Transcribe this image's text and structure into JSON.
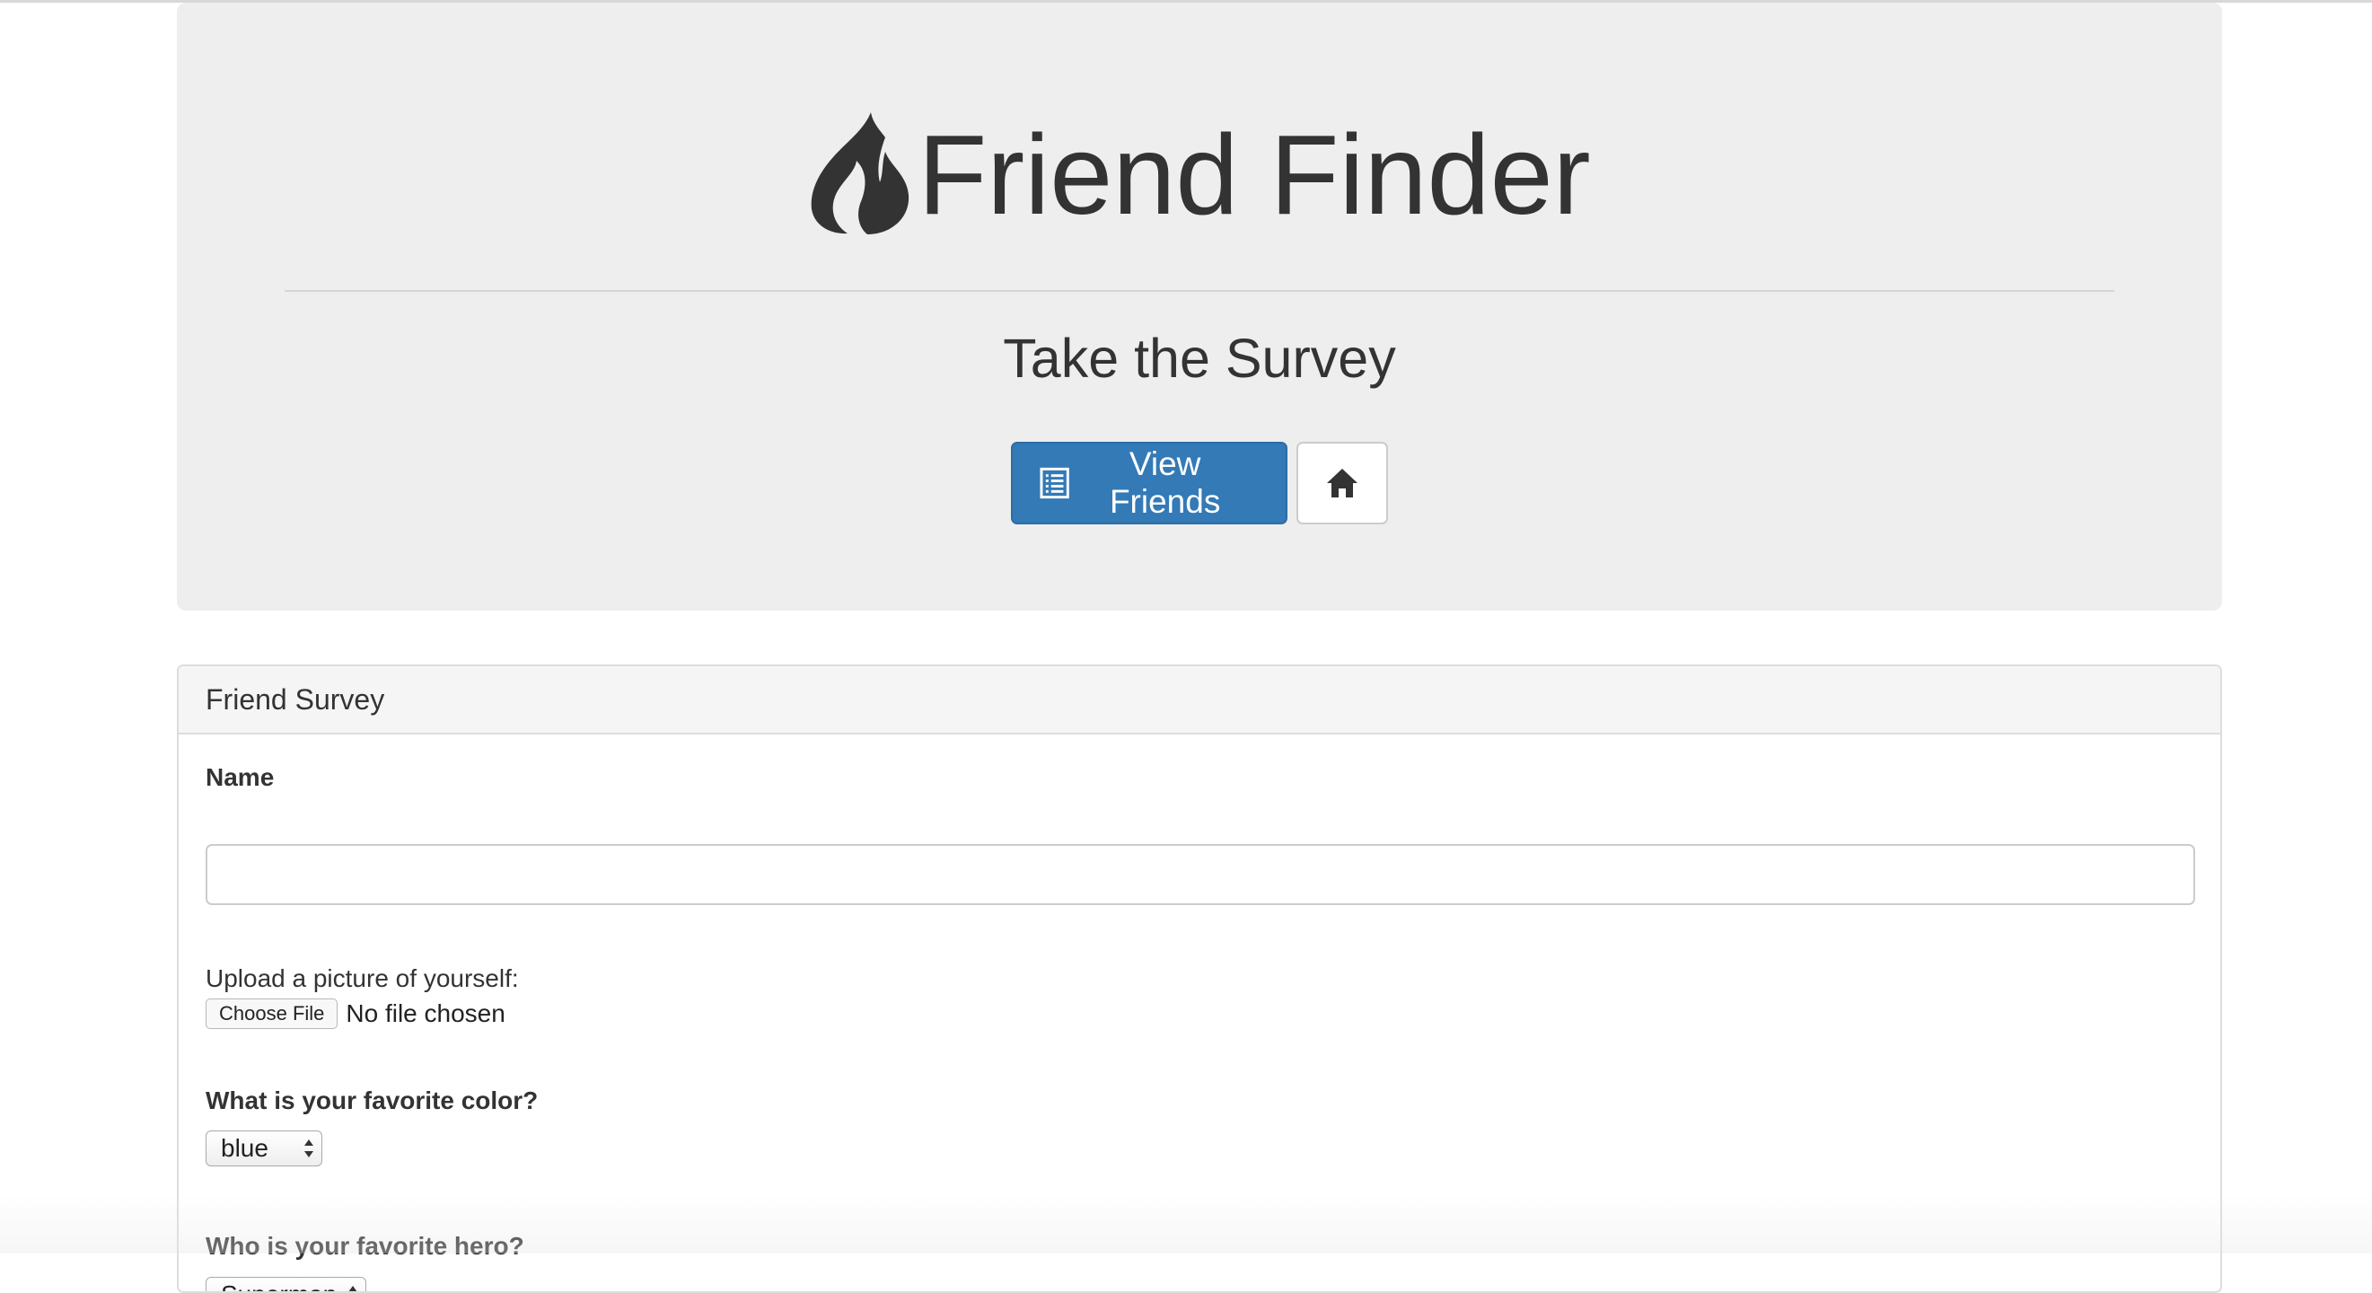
{
  "header": {
    "title": "Friend Finder",
    "subtitle": "Take the Survey",
    "brand_icon": "fire-icon",
    "view_friends_label": "View Friends",
    "view_friends_icon": "list-alt-icon",
    "home_icon": "home-icon"
  },
  "colors": {
    "primary": "#337ab7",
    "jumbotron_bg": "#eeeeee",
    "text": "#333333"
  },
  "survey": {
    "panel_title": "Friend Survey",
    "name_label": "Name",
    "name_value": "",
    "upload_label": "Upload a picture of yourself:",
    "choose_file_label": "Choose File",
    "file_status": "No file chosen",
    "color_question": "What is your favorite color?",
    "color_selected": "blue",
    "hero_question": "Who is your favorite hero?",
    "hero_selected": "Superman"
  }
}
